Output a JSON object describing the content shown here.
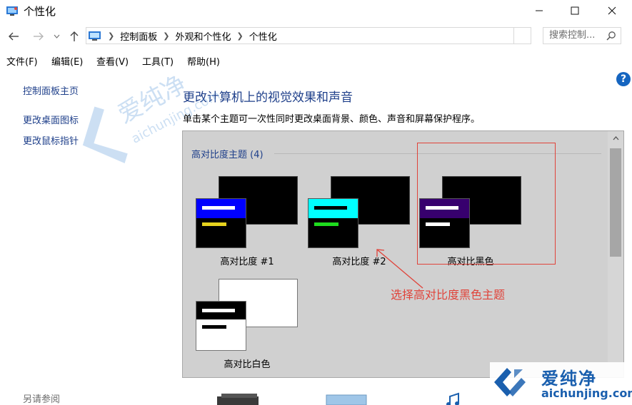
{
  "window": {
    "title": "个性化"
  },
  "address_bar": {
    "crumbs": [
      "控制面板",
      "外观和个性化",
      "个性化"
    ]
  },
  "search": {
    "placeholder": "搜索控制..."
  },
  "menu": {
    "items": [
      "文件(F)",
      "编辑(E)",
      "查看(V)",
      "工具(T)",
      "帮助(H)"
    ]
  },
  "help_label": "?",
  "left_pane": {
    "links": [
      "控制面板主页",
      "更改桌面图标",
      "更改鼠标指针"
    ],
    "see_also": "另请参阅"
  },
  "main": {
    "title": "更改计算机上的视觉效果和声音",
    "description": "单击某个主题可一次性同时更改桌面背景、颜色、声音和屏幕保护程序。"
  },
  "themes_panel": {
    "group_header": "高对比度主题 (4)",
    "themes": [
      {
        "label": "高对比度 #1",
        "header_color": "#0000ff",
        "bar1_color": "#ffffff",
        "bar2_color": "#e6d21e",
        "window_color": "#000000"
      },
      {
        "label": "高对比度 #2",
        "header_color": "#00ffff",
        "bar1_color": "#000000",
        "bar2_color": "#1edc1e",
        "window_color": "#000000"
      },
      {
        "label": "高对比黑色",
        "header_color": "#37006e",
        "bar1_color": "#ffffff",
        "bar2_color": "#ffffff",
        "window_color": "#000000"
      },
      {
        "label": "高对比白色",
        "header_color": "#000000",
        "bar1_color": "#ffffff",
        "bar2_color": "#000000",
        "window_color": "#ffffff"
      }
    ],
    "selected": "高对比黑色"
  },
  "annotation": {
    "text": "选择高对比度黑色主题",
    "color": "#e0433a"
  },
  "watermark": {
    "brand": "爱纯净",
    "url": "aichunjing.com",
    "brand_color": "#1a5fae"
  }
}
